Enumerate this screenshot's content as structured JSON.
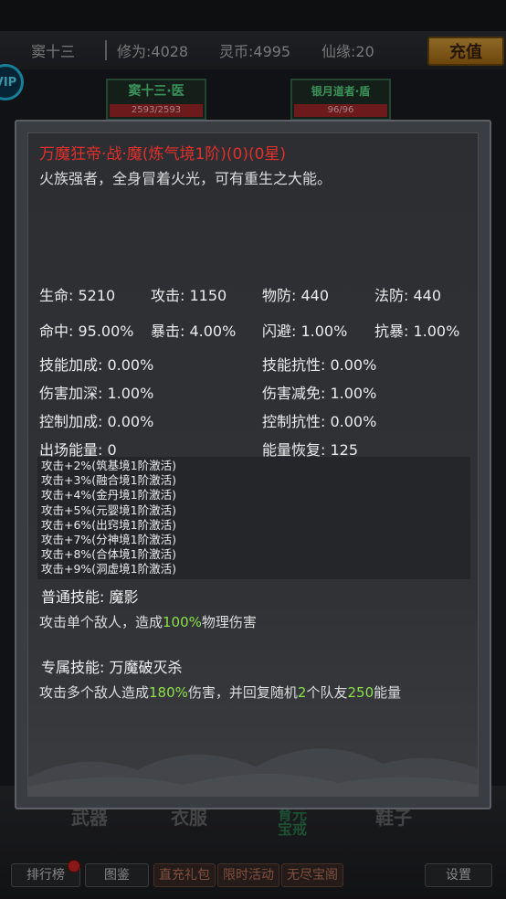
{
  "header": {
    "player_name": "窦十三",
    "cultivation": "修为:4028",
    "spirit_coin": "灵币:4995",
    "immortal_fate": "仙缘:20",
    "recharge_label": "充值"
  },
  "heroes": [
    {
      "name": "窦十三·医",
      "hp": "2593/2593"
    },
    {
      "name": "银月道者·盾",
      "hp": "96/96"
    }
  ],
  "equipment_slots": [
    "武器",
    "衣服",
    "育元宝戒",
    "鞋子"
  ],
  "equipment_slot_3_lines": [
    "育元",
    "宝戒"
  ],
  "bottom_nav": {
    "rank": "排行榜",
    "atlas": "图鉴",
    "gift": "直充礼包",
    "event": "限时活动",
    "treasure": "无尽宝阁",
    "settings": "设置"
  },
  "detail": {
    "title": "万魔狂帝·战·魔(炼气境1阶)(0)(0星)",
    "description": "火族强者，全身冒着火光，可有重生之大能。",
    "stats_row1": [
      "生命: 5210",
      "攻击: 1150",
      "物防: 440",
      "法防: 440"
    ],
    "stats_row2": [
      "命中: 95.00%",
      "暴击: 4.00%",
      "闪避: 1.00%",
      "抗暴: 1.00%"
    ],
    "stats_left": [
      "技能加成: 0.00%",
      "伤害加深: 1.00%",
      "控制加成: 0.00%",
      "出场能量: 0"
    ],
    "stats_right": [
      "技能抗性: 0.00%",
      "伤害减免: 1.00%",
      "控制抗性: 0.00%",
      "能量恢复: 125"
    ],
    "effects": [
      "攻击+2%(筑基境1阶激活)",
      "攻击+3%(融合境1阶激活)",
      "攻击+4%(金丹境1阶激活)",
      "攻击+5%(元婴境1阶激活)",
      "攻击+6%(出窍境1阶激活)",
      "攻击+7%(分神境1阶激活)",
      "攻击+8%(合体境1阶激活)",
      "攻击+9%(洞虚境1阶激活)"
    ],
    "normal_skill": {
      "name": "普通技能: 魔影",
      "desc_prefix": "攻击单个敌人，造成",
      "desc_highlight": "100%",
      "desc_suffix": "物理伤害"
    },
    "special_skill": {
      "name": "专属技能: 万魔破灭杀",
      "desc_part1": "攻击多个敌人造成",
      "desc_hl1": "180%",
      "desc_part2": "伤害，并回复随机",
      "desc_hl2": "2",
      "desc_part3": "个队友",
      "desc_hl3": "250",
      "desc_part4": "能量"
    }
  },
  "colors": {
    "title_red": "#e0302c",
    "highlight_green": "#8ee04a",
    "recharge_gold": "#d9a23c"
  }
}
